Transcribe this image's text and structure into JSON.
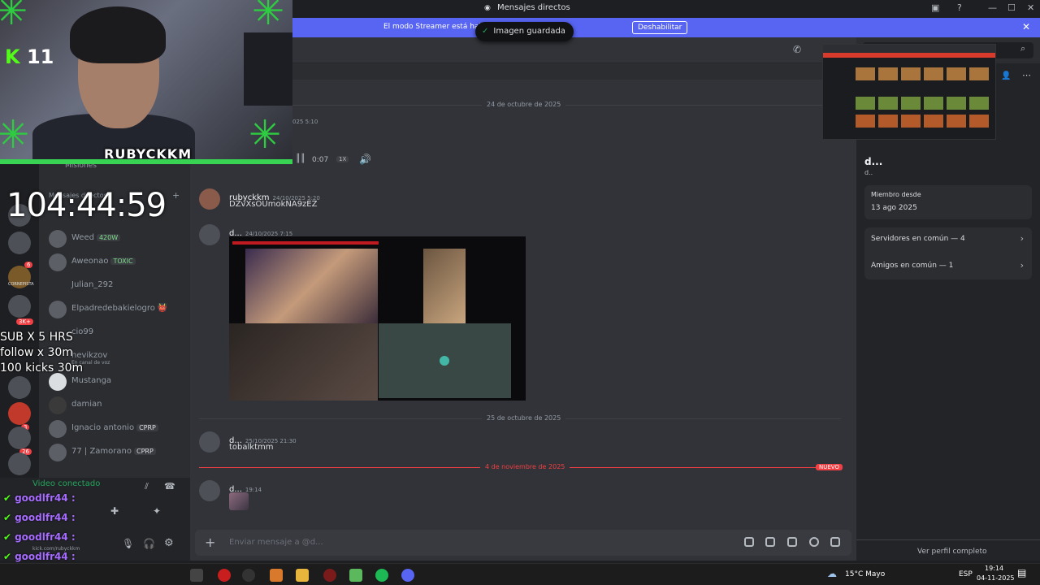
{
  "titlebar": {
    "title": "Mensajes directos",
    "buttons": [
      "—",
      "☐",
      "✕"
    ]
  },
  "banner": {
    "text": "El modo Streamer está habil                                        o se han truncado.",
    "button": "Deshabilitar",
    "close": "✕"
  },
  "toast": {
    "check": "✓",
    "text": "Imagen guardada"
  },
  "sidebar": {
    "section_missions": "Misiones",
    "section_dm": "Mensajes directos",
    "add": "+",
    "items": [
      {
        "name": "Weed",
        "tag": "420W"
      },
      {
        "name": "Aweonao",
        "tag": "TOXIC"
      },
      {
        "name": "Julian_292",
        "tag": ""
      },
      {
        "name": "Elpadredebakielogro",
        "tag": "👹"
      },
      {
        "name": "cio99",
        "tag": ""
      },
      {
        "name": "hevikzov",
        "tag": "",
        "sub": "En canal de voz"
      },
      {
        "name": "Mustanga",
        "tag": ""
      },
      {
        "name": "damian",
        "tag": ""
      },
      {
        "name": "Ignacio antonio",
        "tag": "CPRP"
      },
      {
        "name": "77 | Zamorano",
        "tag": "CPRP"
      }
    ],
    "server_badges": [
      "6",
      "3K+",
      "3",
      "26"
    ],
    "server_label": "CORNEPISTA",
    "voice_status": "Video conectado"
  },
  "chat": {
    "date1": "24 de octubre de 2025",
    "partial_ts": "025 5:10",
    "audio": {
      "time": "0:07",
      "speed": "1X"
    },
    "messages": [
      {
        "user": "rubyckkm",
        "time": "24/10/2025 5:20",
        "text": "DZvXsOUmokNA9zEZ"
      },
      {
        "user": "d...",
        "time": "24/10/2025 7:15",
        "text": ""
      }
    ],
    "date2": "25 de octubre de 2025",
    "msg3": {
      "user": "d...",
      "time": "25/10/2025 21:30",
      "text": "tobalktmm"
    },
    "date3": "4 de noviembre de 2025",
    "new_badge": "NUEVO",
    "msg4": {
      "user": "d...",
      "time": "19:14"
    },
    "composer_placeholder": "Enviar mensaje a @d...",
    "plus": "+"
  },
  "profile": {
    "name": "d...",
    "handle": "d..",
    "member_since_label": "Miembro desde",
    "member_since": "13 ago 2025",
    "servers_common": "Servidores en común — 4",
    "friends_common": "Amigos en común — 1",
    "full_profile": "Ver perfil completo"
  },
  "stream": {
    "kick_count": "11",
    "nick": "RUBYCKKM",
    "timer": "104:44:59",
    "goals": "SUB X 5 HRS\nfollow x 30m\n100 kicks 30m",
    "chat": [
      {
        "user": "goodlfr44",
        "sep": ":"
      },
      {
        "user": "goodlfr44",
        "sep": ":"
      },
      {
        "user": "goodlfr44",
        "sep": ":"
      },
      {
        "user": "goodlfr44",
        "sep": ":"
      },
      {
        "user": "goodlfr44",
        "sep": ":"
      }
    ],
    "kick_url": "kick.com/rubyckkm"
  },
  "taskbar": {
    "weather": "15°C  Mayo",
    "lang": "ESP",
    "time": "19:14",
    "date": "04-11-2025"
  },
  "colors": {
    "accent": "#5865f2",
    "kick_green": "#53fc18",
    "new": "#f23f43"
  }
}
